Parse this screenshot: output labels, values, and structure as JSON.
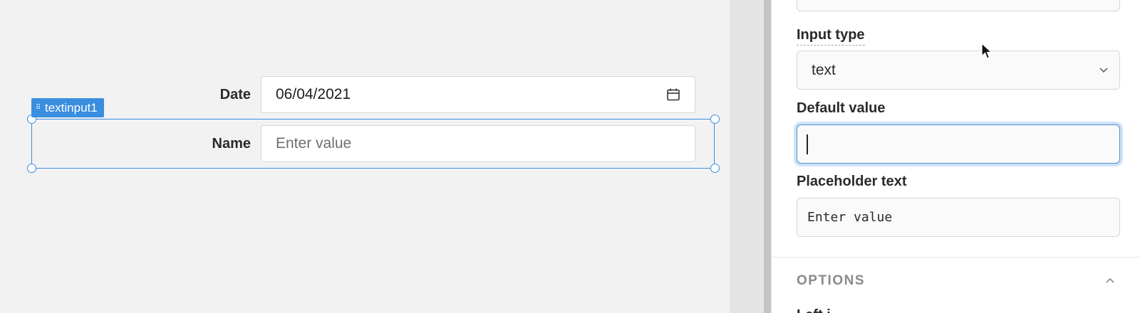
{
  "canvas": {
    "date_field": {
      "label": "Date",
      "value": "06/04/2021"
    },
    "name_field": {
      "label": "Name",
      "placeholder": "Enter value"
    },
    "selection_tag": "textinput1"
  },
  "panel": {
    "input_type_label": "Input type",
    "input_type_value": "text",
    "default_value_label": "Default value",
    "default_value": "",
    "placeholder_label": "Placeholder text",
    "placeholder_value": "Enter value",
    "options_section": "OPTIONS",
    "cutoff_label": "Left i..."
  },
  "colors": {
    "selection": "#3a8ee0",
    "focus_ring": "#cfe2f7"
  }
}
